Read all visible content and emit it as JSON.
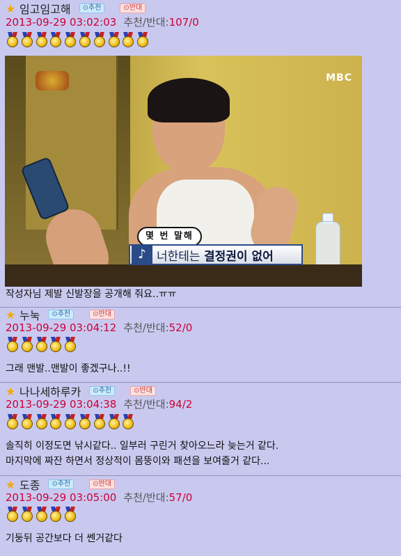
{
  "badge_labels": {
    "recommend": "추천",
    "oppose": "반대"
  },
  "vote_label": "추천/반대:",
  "comments": [
    {
      "nickname": "임고임고해",
      "timestamp": "2013-09-29 03:02:03",
      "votes": "107/0",
      "medal_count": 10,
      "lines": [
        "작성자님 제발 신발장을 공개해 줘요..ㅠㅠ"
      ],
      "video": {
        "broadcaster": "MBC",
        "caption_bubble": "몇 번 말해",
        "caption_prefix": "너한테는 ",
        "caption_emphasis": "결정권이 없어"
      }
    },
    {
      "nickname": "누눅",
      "timestamp": "2013-09-29 03:04:12",
      "votes": "52/0",
      "medal_count": 5,
      "lines": [
        "그래 맨발..맨발이 좋겠구나..!!"
      ]
    },
    {
      "nickname": "나나세하루카",
      "timestamp": "2013-09-29 03:04:38",
      "votes": "94/2",
      "medal_count": 9,
      "lines": [
        "솔직히 이정도면 낚시같다.. 일부러 구린거 찾아오느라 늦는거 같다.",
        "마지막에 짜잔 하면서 정상적이 몸뚱이와 패션을 보여줄거 같다..."
      ]
    },
    {
      "nickname": "도종",
      "timestamp": "2013-09-29 03:05:00",
      "votes": "57/0",
      "medal_count": 5,
      "lines": [
        "기둥뒤 공간보다 더 쎈거같다"
      ]
    }
  ],
  "colors": {
    "page_bg": "#c9c9f0",
    "timestamp": "#cc0033",
    "star": "#f2a900"
  },
  "icons": [
    "star-icon",
    "medal-icon",
    "music-note-icon"
  ]
}
